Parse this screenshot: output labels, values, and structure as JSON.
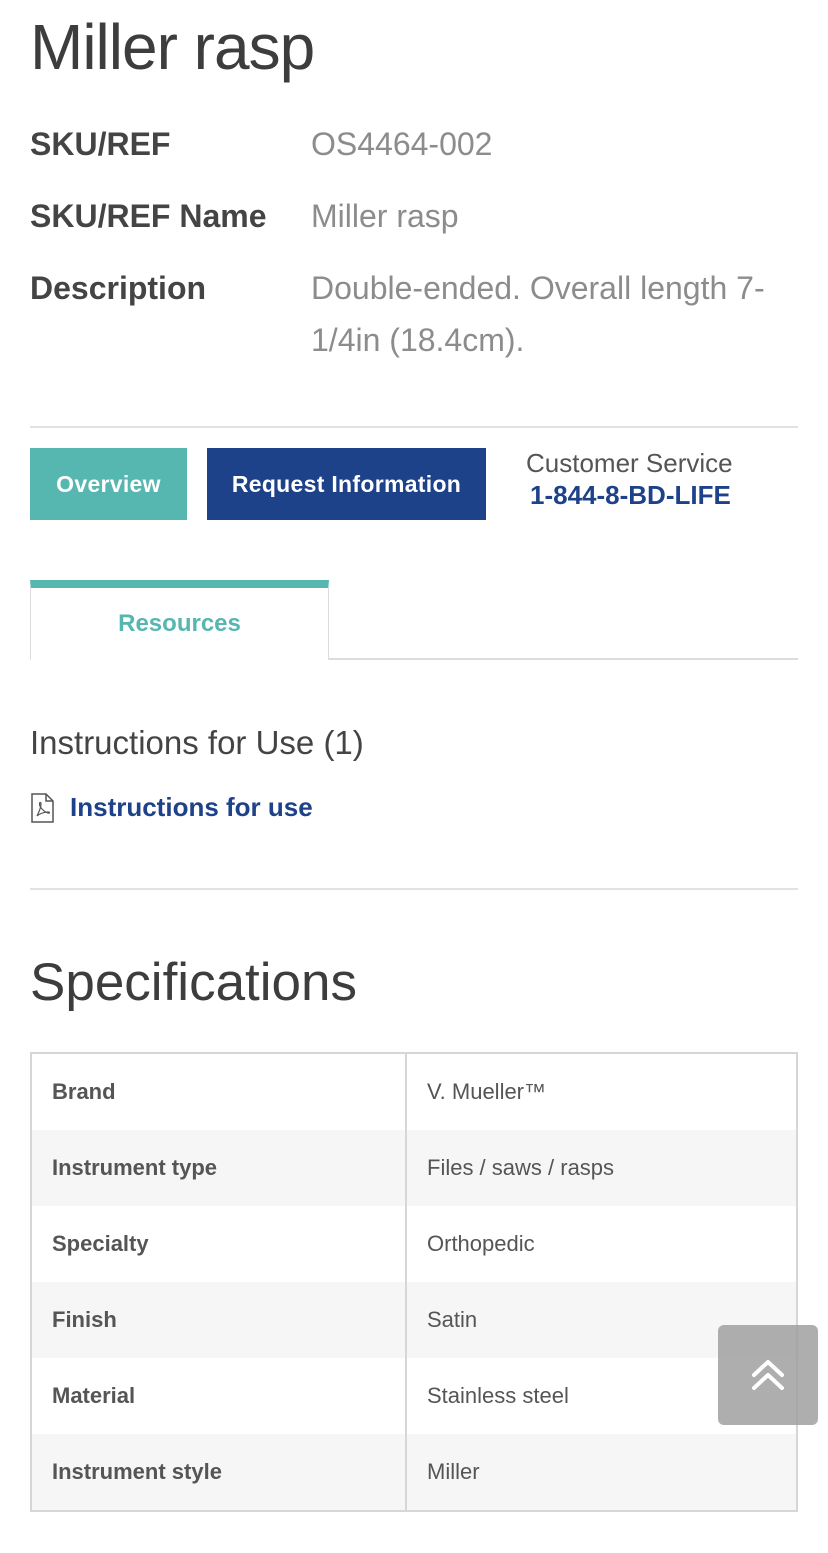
{
  "product": {
    "title": "Miller rasp",
    "attributes": [
      {
        "label": "SKU/REF",
        "value": "OS4464-002"
      },
      {
        "label": "SKU/REF Name",
        "value": "Miller rasp"
      },
      {
        "label": "Description",
        "value": "Double-ended. Overall length 7-1/4in (18.4cm)."
      }
    ]
  },
  "actions": {
    "overview_label": "Overview",
    "request_label": "Request Information",
    "customer_service_label": "Customer Service",
    "customer_service_phone": "1-844-8-BD-LIFE"
  },
  "tabs": {
    "active": "Resources"
  },
  "resources": {
    "heading": "Instructions for Use (1)",
    "link_label": "Instructions for use",
    "link_icon": "pdf-file-icon"
  },
  "specifications": {
    "title": "Specifications",
    "rows": [
      {
        "key": "Brand",
        "value": "V. Mueller™"
      },
      {
        "key": "Instrument type",
        "value": "Files / saws / rasps"
      },
      {
        "key": "Specialty",
        "value": "Orthopedic"
      },
      {
        "key": "Finish",
        "value": "Satin"
      },
      {
        "key": "Material",
        "value": "Stainless steel"
      },
      {
        "key": "Instrument style",
        "value": "Miller"
      }
    ]
  },
  "back_to_top": {
    "icon": "double-chevron-up-icon"
  },
  "colors": {
    "teal": "#56b6b0",
    "navy": "#1d428a",
    "muted_text": "#8c8c8c"
  }
}
